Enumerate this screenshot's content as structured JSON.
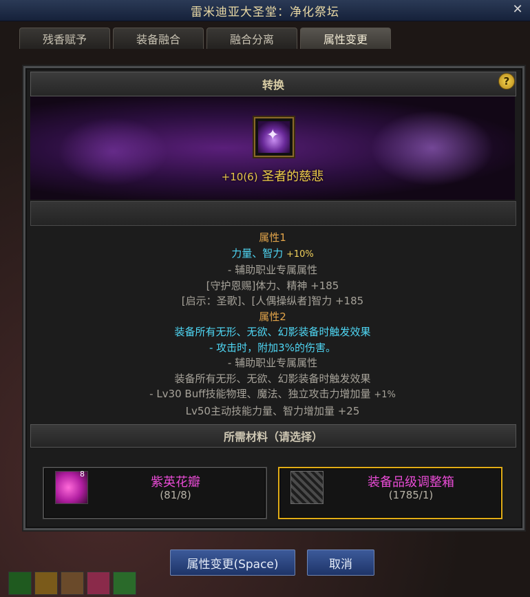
{
  "window": {
    "title": "雷米迪亚大圣堂：净化祭坛",
    "close": "✕"
  },
  "tabs": [
    {
      "label": "残香赋予",
      "active": false
    },
    {
      "label": "装备融合",
      "active": false
    },
    {
      "label": "融合分离",
      "active": false
    },
    {
      "label": "属性变更",
      "active": true
    }
  ],
  "section": {
    "title": "转换",
    "help": "?"
  },
  "item": {
    "name_prefix": "+10(6)",
    "name": "圣者的慈悲"
  },
  "properties": {
    "attr1_label": "属性1",
    "attr1_main": "力量、智力",
    "attr1_main_value": "+10%",
    "attr1_line1": "- 辅助职业专属属性",
    "attr1_line2": "[守护恩赐]体力、精神 +185",
    "attr1_line3": "[启示：圣歌]、[人偶操纵者]智力 +185",
    "attr2_label": "属性2",
    "attr2_main1": "装备所有无形、无欲、幻影装备时触发效果",
    "attr2_main2": "- 攻击时，附加3%的伤害。",
    "attr2_line1": "- 辅助职业专属属性",
    "attr2_line2": "装备所有无形、无欲、幻影装备时触发效果",
    "attr2_line3": "- Lv30 Buff技能物理、魔法、独立攻击力增加量",
    "attr2_line3_value": "+1%",
    "attr2_line4": "Lv50主动技能力量、智力增加量 +25"
  },
  "materials": {
    "title": "所需材料（请选择）",
    "items": [
      {
        "name": "紫英花瓣",
        "count": "(81/8)",
        "selected": false,
        "badge": "8"
      },
      {
        "name": "装备品级调整箱",
        "count": "(1785/1)",
        "selected": true
      }
    ]
  },
  "buttons": {
    "confirm": "属性变更(Space)",
    "cancel": "取消"
  }
}
